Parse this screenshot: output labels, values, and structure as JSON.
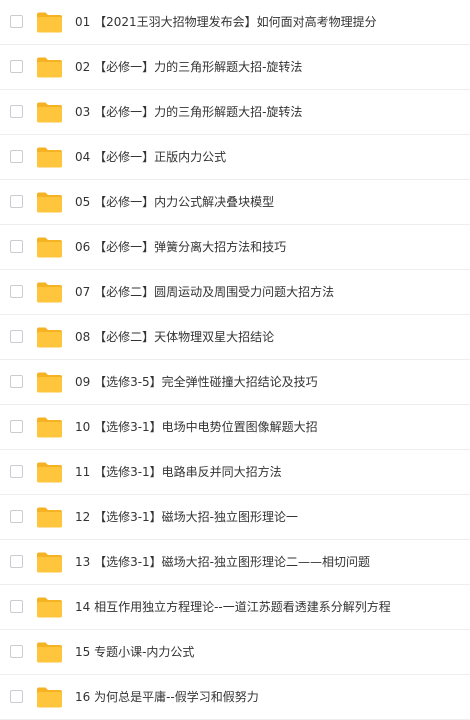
{
  "colors": {
    "folder_body": "#ffc53d",
    "folder_tab": "#f5b223",
    "checkbox_border": "#c9ccd2",
    "divider": "#eceef1",
    "text": "#333333"
  },
  "files": [
    {
      "name": "01 【2021王羽大招物理发布会】如何面对高考物理提分",
      "icon": "folder-icon"
    },
    {
      "name": "02 【必修一】力的三角形解题大招-旋转法",
      "icon": "folder-icon"
    },
    {
      "name": "03 【必修一】力的三角形解题大招-旋转法",
      "icon": "folder-icon"
    },
    {
      "name": "04 【必修一】正版内力公式",
      "icon": "folder-icon"
    },
    {
      "name": "05 【必修一】内力公式解决叠块模型",
      "icon": "folder-icon"
    },
    {
      "name": "06 【必修一】弹簧分离大招方法和技巧",
      "icon": "folder-icon"
    },
    {
      "name": "07 【必修二】圆周运动及周围受力问题大招方法",
      "icon": "folder-icon"
    },
    {
      "name": "08 【必修二】天体物理双星大招结论",
      "icon": "folder-icon"
    },
    {
      "name": "09 【选修3-5】完全弹性碰撞大招结论及技巧",
      "icon": "folder-icon"
    },
    {
      "name": "10 【选修3-1】电场中电势位置图像解题大招",
      "icon": "folder-icon"
    },
    {
      "name": "11 【选修3-1】电路串反并同大招方法",
      "icon": "folder-icon"
    },
    {
      "name": "12 【选修3-1】磁场大招-独立图形理论一",
      "icon": "folder-icon"
    },
    {
      "name": "13 【选修3-1】磁场大招-独立图形理论二——相切问题",
      "icon": "folder-icon"
    },
    {
      "name": "14 相互作用独立方程理论--一道江苏题看透建系分解列方程",
      "icon": "folder-icon"
    },
    {
      "name": "15 专题小课-内力公式",
      "icon": "folder-icon"
    },
    {
      "name": "16 为何总是平庸--假学习和假努力",
      "icon": "folder-icon"
    }
  ]
}
